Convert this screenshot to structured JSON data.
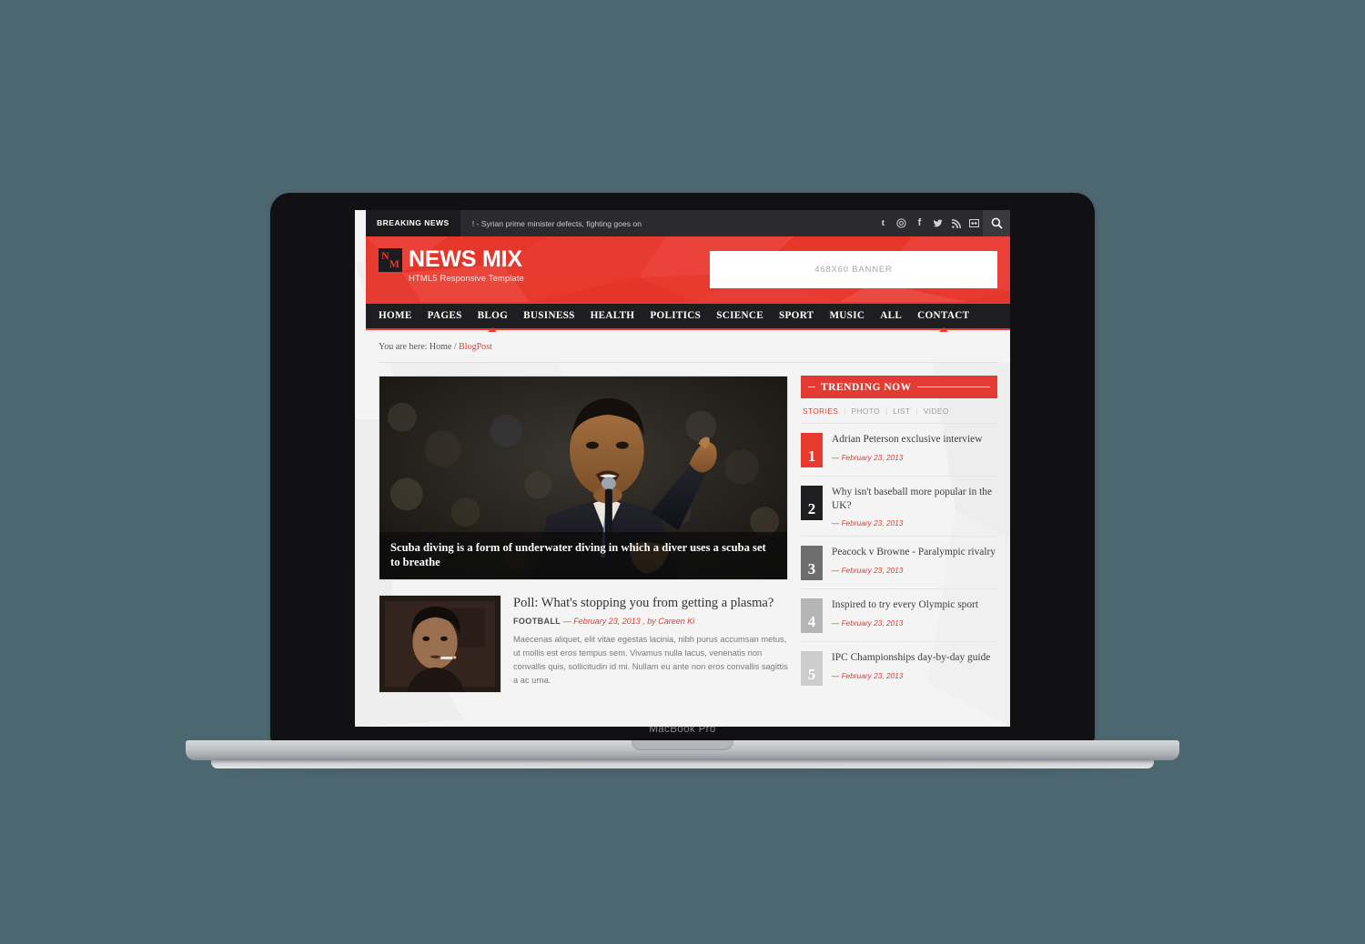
{
  "device": {
    "model_label": "MacBook Pro"
  },
  "topbar": {
    "breaking_label": "BREAKING NEWS",
    "ticker_text": "! - Syrian prime minister defects, fighting goes on",
    "social": [
      {
        "name": "tumblr-icon",
        "glyph": "t"
      },
      {
        "name": "instagram-icon",
        "glyph": "@"
      },
      {
        "name": "facebook-icon",
        "glyph": "f"
      },
      {
        "name": "twitter-icon",
        "glyph": "t"
      },
      {
        "name": "rss-icon",
        "glyph": "rss"
      },
      {
        "name": "flickr-icon",
        "glyph": "sq"
      }
    ]
  },
  "header": {
    "brand_name": "NEWS MIX",
    "brand_tagline": "HTML5 Responsive Template",
    "logo_letter_1": "N",
    "logo_letter_2": "M",
    "banner_text": "468X60 BANNER"
  },
  "nav": {
    "items": [
      {
        "label": "HOME",
        "active": false
      },
      {
        "label": "PAGES",
        "active": false
      },
      {
        "label": "BLOG",
        "active": true
      },
      {
        "label": "BUSINESS",
        "active": false
      },
      {
        "label": "HEALTH",
        "active": false
      },
      {
        "label": "POLITICS",
        "active": false
      },
      {
        "label": "SCIENCE",
        "active": false
      },
      {
        "label": "SPORT",
        "active": false
      },
      {
        "label": "MUSIC",
        "active": false
      },
      {
        "label": "ALL",
        "active": false
      },
      {
        "label": "CONTACT",
        "active": true
      }
    ]
  },
  "breadcrumb": {
    "prefix": "You are here: Home",
    "separator": "/",
    "current": "BlogPost"
  },
  "hero": {
    "caption": "Scuba diving is a form of underwater diving in which a diver uses a scuba set to breathe"
  },
  "post": {
    "title": "Poll: What's stopping you from getting a plasma?",
    "category": "FOOTBALL",
    "meta_dash": "—",
    "date_author": "February 23, 2013 , by Careen Ki",
    "excerpt": "Maecenas aliquet, elit vitae egestas lacinia, nibh purus accumsan metus, ut mollis est eros tempus sem. Vivamus nulla lacus, venenatis non convallis quis, sollicitudin id mi. Nullam eu ante non eros convallis sagittis a ac urna."
  },
  "sidebar": {
    "widget_title": "TRENDING NOW",
    "tabs": [
      {
        "label": "STORIES",
        "active": true
      },
      {
        "label": "PHOTO",
        "active": false
      },
      {
        "label": "LIST",
        "active": false
      },
      {
        "label": "VIDEO",
        "active": false
      }
    ],
    "items": [
      {
        "rank": "1",
        "title": "Adrian Peterson exclusive interview",
        "date": "— February 23, 2013",
        "badge_color": "#e8392e"
      },
      {
        "rank": "2",
        "title": "Why isn't baseball more popular in the UK?",
        "date": "— February 23, 2013",
        "badge_color": "#1f1f21"
      },
      {
        "rank": "3",
        "title": "Peacock v Browne - Paralympic rivalry",
        "date": "— February 23, 2013",
        "badge_color": "#6e6e6e"
      },
      {
        "rank": "4",
        "title": "Inspired to try every Olympic sport",
        "date": "— February 23, 2013",
        "badge_color": "#b5b5b5"
      },
      {
        "rank": "5",
        "title": "IPC Championships day-by-day guide",
        "date": "— February 23, 2013",
        "badge_color": "#cccccc"
      }
    ]
  },
  "colors": {
    "accent_red": "#e8392e",
    "dark_nav": "#1e1e20",
    "topbar": "#2b2b2d",
    "canvas": "#4d6771"
  }
}
